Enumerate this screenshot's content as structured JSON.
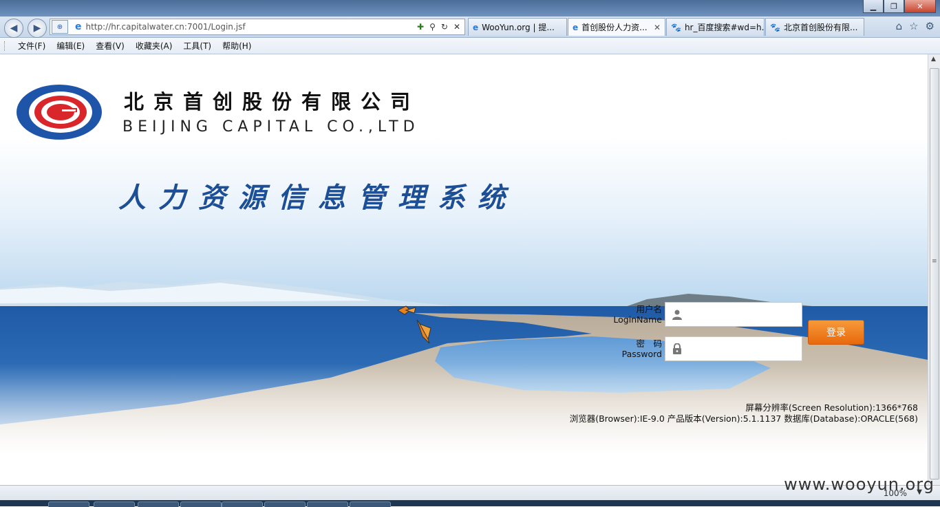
{
  "browser": {
    "url": "http://hr.capitalwater.cn:7001/Login.jsf",
    "tabs": [
      {
        "label": "WooYun.org | 提...",
        "icon": "ie-icon",
        "active": false
      },
      {
        "label": "首创股份人力资...",
        "icon": "ie-icon",
        "active": true
      },
      {
        "label": "hr_百度搜索#wd=h...",
        "icon": "baidu-paw-icon",
        "active": false
      },
      {
        "label": "北京首创股份有限...",
        "icon": "baidu-paw-icon",
        "active": false
      }
    ],
    "menu": [
      "文件(F)",
      "编辑(E)",
      "查看(V)",
      "收藏夹(A)",
      "工具(T)",
      "帮助(H)"
    ],
    "zoom": "100%"
  },
  "page": {
    "company_cn": "北京首创股份有限公司",
    "company_en": "BEIJING CAPITAL CO.,LTD",
    "system_title": "人力资源信息管理系统",
    "login": {
      "username_label_cn": "用户名",
      "username_label_en": "LoginName",
      "password_label_cn": "密　码",
      "password_label_en": "Password",
      "username_value": "",
      "password_value": "",
      "submit_label": "登录"
    },
    "info": {
      "resolution": "屏幕分辨率(Screen Resolution):1366*768",
      "env": "浏览器(Browser):IE-9.0 产品版本(Version):5.1.1137 数据库(Database):ORACLE(568)"
    },
    "colors": {
      "brand_blue": "#1d4f96",
      "logo_red": "#d8262b",
      "login_button": "#ef7d1e"
    }
  },
  "watermark": "www.wooyun.org"
}
